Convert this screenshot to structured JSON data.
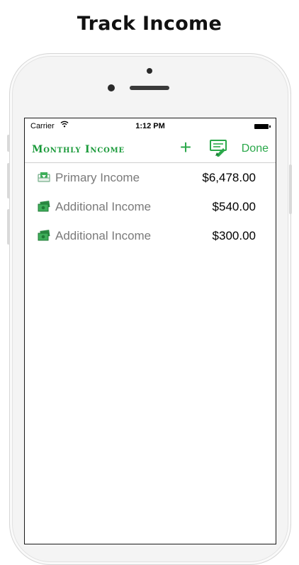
{
  "headline": "Track Income",
  "status_bar": {
    "carrier": "Carrier",
    "time": "1:12 PM"
  },
  "nav": {
    "title": "Monthly Income",
    "add_icon": "plus-icon",
    "edit_icon": "edit-money-icon",
    "done_label": "Done"
  },
  "colors": {
    "accent": "#2aa84a",
    "title_green": "#1a9a3a",
    "label_gray": "#7a7a7a"
  },
  "income_items": [
    {
      "label": "Primary Income",
      "amount": "$6,478.00",
      "icon": "primary-income-icon"
    },
    {
      "label": "Additional Income",
      "amount": "$540.00",
      "icon": "additional-income-icon"
    },
    {
      "label": "Additional Income",
      "amount": "$300.00",
      "icon": "additional-income-icon"
    }
  ]
}
